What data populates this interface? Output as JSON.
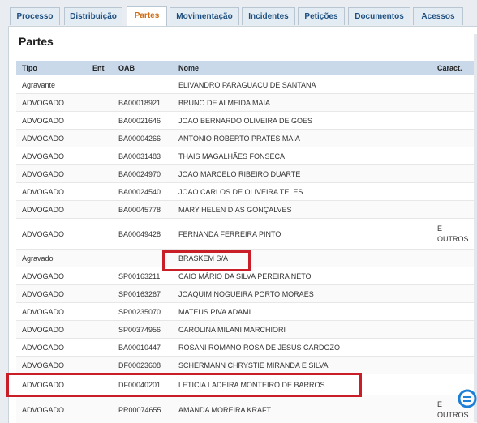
{
  "tabs": [
    {
      "label": "Processo",
      "active": false
    },
    {
      "label": "Distribuição",
      "active": false
    },
    {
      "label": "Partes",
      "active": true
    },
    {
      "label": "Movimentação",
      "active": false
    },
    {
      "label": "Incidentes",
      "active": false
    },
    {
      "label": "Petições",
      "active": false
    },
    {
      "label": "Documentos",
      "active": false
    },
    {
      "label": "Acessos",
      "active": false
    }
  ],
  "section_title": "Partes",
  "columns": {
    "tipo": "Tipo",
    "ent": "Ent",
    "oab": "OAB",
    "nome": "Nome",
    "caract": "Caract."
  },
  "rows": [
    {
      "tipo": "Agravante",
      "ent": "",
      "oab": "",
      "nome": "ELIVANDRO PARAGUACU DE SANTANA",
      "caract": ""
    },
    {
      "tipo": "ADVOGADO",
      "ent": "",
      "oab": "BA00018921",
      "nome": "BRUNO DE ALMEIDA MAIA",
      "caract": ""
    },
    {
      "tipo": "ADVOGADO",
      "ent": "",
      "oab": "BA00021646",
      "nome": "JOAO BERNARDO OLIVEIRA DE GOES",
      "caract": ""
    },
    {
      "tipo": "ADVOGADO",
      "ent": "",
      "oab": "BA00004266",
      "nome": "ANTONIO ROBERTO PRATES MAIA",
      "caract": ""
    },
    {
      "tipo": "ADVOGADO",
      "ent": "",
      "oab": "BA00031483",
      "nome": "THAIS MAGALHÃES FONSECA",
      "caract": ""
    },
    {
      "tipo": "ADVOGADO",
      "ent": "",
      "oab": "BA00024970",
      "nome": "JOAO MARCELO RIBEIRO DUARTE",
      "caract": ""
    },
    {
      "tipo": "ADVOGADO",
      "ent": "",
      "oab": "BA00024540",
      "nome": "JOAO CARLOS DE OLIVEIRA TELES",
      "caract": ""
    },
    {
      "tipo": "ADVOGADO",
      "ent": "",
      "oab": "BA00045778",
      "nome": "MARY HELEN DIAS GONÇALVES",
      "caract": ""
    },
    {
      "tipo": "ADVOGADO",
      "ent": "",
      "oab": "BA00049428",
      "nome": "FERNANDA FERREIRA PINTO",
      "caract": "E OUTROS"
    },
    {
      "tipo": "Agravado",
      "ent": "",
      "oab": "",
      "nome": "BRASKEM S/A",
      "caract": ""
    },
    {
      "tipo": "ADVOGADO",
      "ent": "",
      "oab": "SP00163211",
      "nome": "CAIO MÁRIO DA SILVA PEREIRA NETO",
      "caract": ""
    },
    {
      "tipo": "ADVOGADO",
      "ent": "",
      "oab": "SP00163267",
      "nome": "JOAQUIM NOGUEIRA PORTO MORAES",
      "caract": ""
    },
    {
      "tipo": "ADVOGADO",
      "ent": "",
      "oab": "SP00235070",
      "nome": "MATEUS PIVA ADAMI",
      "caract": ""
    },
    {
      "tipo": "ADVOGADO",
      "ent": "",
      "oab": "SP00374956",
      "nome": "CAROLINA MILANI MARCHIORI",
      "caract": ""
    },
    {
      "tipo": "ADVOGADO",
      "ent": "",
      "oab": "BA00010447",
      "nome": "ROSANI ROMANO ROSA DE JESUS CARDOZO",
      "caract": ""
    },
    {
      "tipo": "ADVOGADO",
      "ent": "",
      "oab": "DF00023608",
      "nome": "SCHERMANN CHRYSTIE MIRANDA E SILVA",
      "caract": ""
    },
    {
      "tipo": "ADVOGADO",
      "ent": "",
      "oab": "DF00040201",
      "nome": "LETICIA LADEIRA MONTEIRO DE BARROS",
      "caract": ""
    },
    {
      "tipo": "ADVOGADO",
      "ent": "",
      "oab": "PR00074655",
      "nome": "AMANDA MOREIRA KRAFT",
      "caract": "E OUTROS"
    }
  ],
  "colors": {
    "highlight": "#c91e28",
    "header_bg": "#c9d9ea",
    "active_tab_text": "#d06b12",
    "tab_text": "#1d4f80"
  },
  "icons": {
    "watermark": "watermark-logo-icon"
  }
}
